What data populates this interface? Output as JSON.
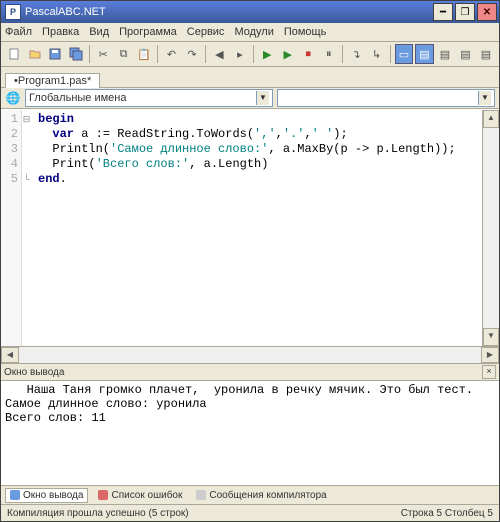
{
  "window": {
    "title": "PascalABC.NET"
  },
  "menu": {
    "items": [
      "Файл",
      "Правка",
      "Вид",
      "Программа",
      "Сервис",
      "Модули",
      "Помощь"
    ]
  },
  "tab": {
    "label": "•Program1.pas*"
  },
  "dropdown": {
    "value": "Глобальные имена"
  },
  "code": {
    "lines": [
      {
        "n": "1",
        "html": "<span class='kw'>begin</span>"
      },
      {
        "n": "2",
        "html": "  <span class='kw'>var</span> a := ReadString.ToWords(<span class='str'>','</span>,<span class='str'>'.'</span>,<span class='str'>' '</span>);"
      },
      {
        "n": "3",
        "html": "  Println(<span class='str'>'Самое длинное слово:'</span>, a.MaxBy(p -> p.Length));"
      },
      {
        "n": "4",
        "html": "  Print(<span class='str'>'Всего слов:'</span>, a.Length)"
      },
      {
        "n": "5",
        "html": "<span class='kw'>end</span>."
      }
    ]
  },
  "output": {
    "title": "Окно вывода",
    "lines": [
      "   Наша Таня громко плачет,  уронила в речку мячик. Это был тест.",
      "Самое длинное слово: уронила",
      "Всего слов: 11"
    ]
  },
  "bottomTabs": {
    "t1": "Окно вывода",
    "t2": "Список ошибок",
    "t3": "Сообщения компилятора"
  },
  "status": {
    "left": "Компиляция прошла успешно (5 строк)",
    "right": "Строка  5 Столбец  5"
  }
}
